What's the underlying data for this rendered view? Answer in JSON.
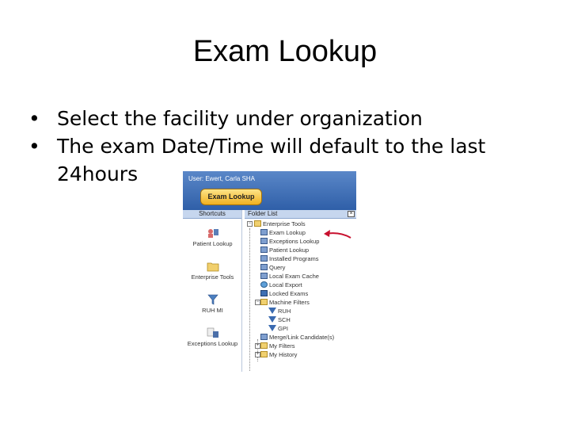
{
  "slide": {
    "title": "Exam Lookup",
    "bullets": [
      "Select the facility under organization",
      "The exam Date/Time will default to the last 24hours"
    ]
  },
  "screenshot": {
    "user_line": "User: Ewert, Carla SHA",
    "exam_lookup_button": "Exam Lookup",
    "shortcuts": {
      "header": "Shortcuts",
      "items": [
        {
          "label": "Patient Lookup",
          "icon": "patient-lookup-icon"
        },
        {
          "label": "Enterprise Tools",
          "icon": "folder-icon"
        },
        {
          "label": "RUH MI",
          "icon": "filter-icon"
        },
        {
          "label": "Exceptions Lookup",
          "icon": "exceptions-lookup-icon"
        }
      ]
    },
    "folder_list": {
      "header": "Folder List",
      "close": "×",
      "root": "Enterprise Tools",
      "items": [
        "Exam Lookup",
        "Exceptions Lookup",
        "Patient Lookup",
        "Installed Programs",
        "Query",
        "Local Exam Cache",
        "Local Export",
        "Locked Exams",
        "Machine Filters",
        "RUH",
        "SCH",
        "GPI",
        "Merge/Link Candidate(s)",
        "My Filters",
        "My History"
      ]
    },
    "colors": {
      "header_blue": "#2f5fa8",
      "button_gold": "#f0b020",
      "arrow_red": "#c8102e"
    }
  }
}
